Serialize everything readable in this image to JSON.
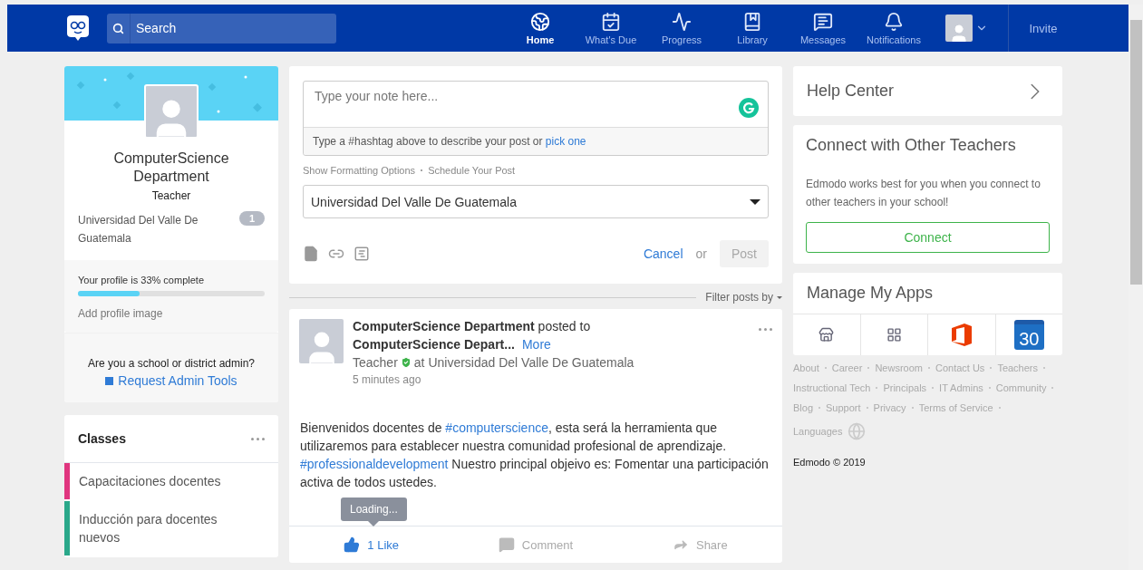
{
  "navbar": {
    "search": {
      "placeholder": "Search"
    },
    "items": [
      {
        "label": "Home",
        "kind": "home",
        "selected": true
      },
      {
        "label": "What's Due",
        "kind": "due",
        "selected": false
      },
      {
        "label": "Progress",
        "kind": "progress",
        "selected": false
      },
      {
        "label": "Library",
        "kind": "library",
        "selected": false
      },
      {
        "label": "Messages",
        "kind": "messages",
        "selected": false
      },
      {
        "label": "Notifications",
        "kind": "notifications",
        "selected": false
      }
    ],
    "invite": "Invite"
  },
  "profile": {
    "name": "ComputerScience Department",
    "role": "Teacher",
    "school": "Universidad Del Valle De Guatemala",
    "school_count": "1",
    "completion": {
      "label": "Your profile is 33% complete",
      "level": 0.33,
      "action": "Add profile image"
    },
    "admin_question": "Are you a school or district admin?",
    "admin_link": "Request Admin Tools"
  },
  "classes": {
    "title": "Classes",
    "items": [
      {
        "name": "Capacitaciones docentes",
        "color": "#e0357f"
      },
      {
        "name": "Inducción para docentes nuevos",
        "color": "#2aa88a"
      }
    ]
  },
  "composer": {
    "placeholder": "Type your note here...",
    "hashtag_hint": "Type a #hashtag above to describe your post or ",
    "hashtag_link": "pick one",
    "options": [
      "Show Formatting Options",
      "Schedule Your Post"
    ],
    "recipient": "Universidad Del Valle De Guatemala",
    "cancel": "Cancel",
    "or": "or",
    "post": "Post",
    "post_disabled": true
  },
  "filter": "Filter posts by",
  "post": {
    "header": "**ComputerScience Department** posted to",
    "target": "ComputerScience Depart...",
    "more": "More",
    "role": "Teacher",
    "verified": true,
    "school": "at Universidad Del Valle De Guatemala",
    "time": "5 minutes ago",
    "body": [
      {
        "kind": "text",
        "text": "Bienvenidos docentes de "
      },
      {
        "kind": "hashtag",
        "text": "#computerscience"
      },
      {
        "kind": "text",
        "text": ", esta será la herramienta que utilizaremos para establecer nuestra comunidad profesional de aprendizaje. "
      },
      {
        "kind": "hashtag",
        "text": "#professionaldevelopment"
      },
      {
        "kind": "text",
        "text": " Nuestro principal objeivo es: Fomentar una participación activa de todos ustedes."
      }
    ],
    "tooltip": "Loading...",
    "actions": [
      {
        "kind": "like",
        "label": "1 Like",
        "selected": true
      },
      {
        "kind": "comment",
        "label": "Comment",
        "selected": false
      },
      {
        "kind": "share",
        "label": "Share",
        "selected": false
      }
    ]
  },
  "help": {
    "title": "Help Center"
  },
  "connect": {
    "title": "Connect with Other Teachers",
    "text": "Edmodo works best for you when you connect to other teachers in your school!",
    "button": "Connect"
  },
  "apps": {
    "title": "Manage My Apps",
    "items": [
      {
        "kind": "store"
      },
      {
        "kind": "grid"
      },
      {
        "kind": "office"
      },
      {
        "kind": "calendar",
        "label": "30"
      }
    ]
  },
  "footer": {
    "links": [
      "About",
      "Career",
      "Newsroom",
      "Contact Us",
      "Teachers",
      "Instructional Tech",
      "Principals",
      "IT Admins",
      "Community",
      "Blog",
      "Support",
      "Privacy",
      "Terms of Service"
    ],
    "languages": "Languages",
    "copyright": "Edmodo © 2019"
  }
}
